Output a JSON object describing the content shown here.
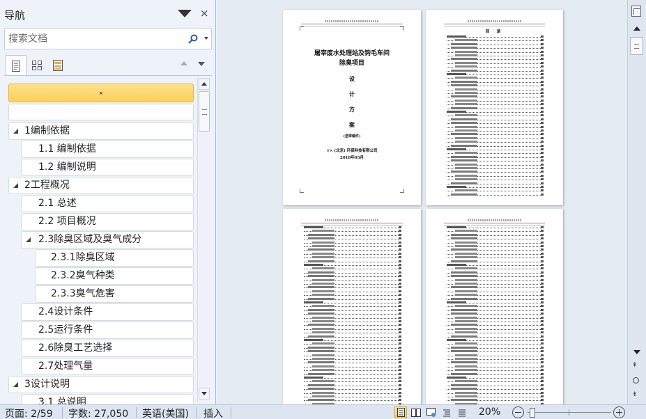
{
  "nav": {
    "title": "导航",
    "close_glyph": "×",
    "search_placeholder": "搜索文档",
    "icons": {
      "search": "magnifier-icon",
      "menu": "triangle-down-icon",
      "tab_headings": "headings-icon",
      "tab_pages": "thumbnails-icon",
      "tab_results": "results-icon"
    },
    "tree_top_glyph": "⌅",
    "headings": [
      {
        "label": "1编制依据",
        "level": 1,
        "expanded": true
      },
      {
        "label": "1.1 编制依据",
        "level": 2
      },
      {
        "label": "1.2 编制说明",
        "level": 2
      },
      {
        "label": "2工程概况",
        "level": 1,
        "expanded": true
      },
      {
        "label": "2.1 总述",
        "level": 2
      },
      {
        "label": "2.2 项目概况",
        "level": 2
      },
      {
        "label": "2.3除臭区域及臭气成分",
        "level": 2,
        "expanded": true
      },
      {
        "label": "2.3.1除臭区域",
        "level": 3
      },
      {
        "label": "2.3.2臭气种类",
        "level": 3
      },
      {
        "label": "2.3.3臭气危害",
        "level": 3
      },
      {
        "label": "2.4设计条件",
        "level": 2
      },
      {
        "label": "2.5运行条件",
        "level": 2
      },
      {
        "label": "2.6除臭工艺选择",
        "level": 2
      },
      {
        "label": "2.7处理气量",
        "level": 2
      },
      {
        "label": "3设计说明",
        "level": 1,
        "expanded": true
      },
      {
        "label": "3.1 总说明",
        "level": 2
      }
    ]
  },
  "document": {
    "cover": {
      "title_line1": "屠宰废水处理站及钩毛车间",
      "title_line2": "除臭项目",
      "chars": [
        "设",
        "计",
        "方",
        "案"
      ],
      "subtitle": "(送审稿件)",
      "company": "×× (北京) 环保科技有限公司",
      "date": "2018年03月"
    },
    "toc_title": "目 录"
  },
  "scrollbar": {
    "prev_glyph": "⇞",
    "next_glyph": "⇟"
  },
  "status": {
    "page": "页面: 2/59",
    "words": "字数: 27,050",
    "language": "英语(美国)",
    "mode": "插入",
    "zoom": "20%",
    "zoom_level_percent": 20
  }
}
